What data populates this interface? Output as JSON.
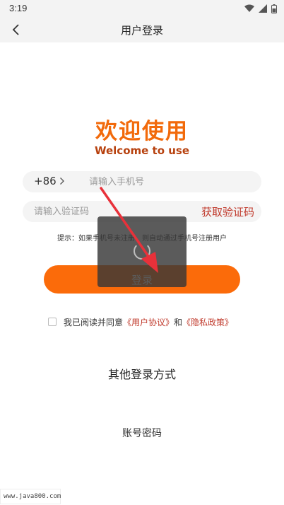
{
  "status_bar": {
    "time": "3:19"
  },
  "header": {
    "title": "用户登录"
  },
  "welcome": {
    "title_cn": "欢迎使用",
    "title_en": "Welcome to use"
  },
  "phone": {
    "country_code": "+86",
    "placeholder": "请输入手机号"
  },
  "code": {
    "placeholder": "请输入验证码",
    "get_code_label": "获取验证码"
  },
  "hint": "提示：如果手机号未注册，则自动通过手机号注册用户",
  "login_button": "登录",
  "agreement": {
    "prefix": "我已阅读并同意",
    "user_agreement": "《用户协议》",
    "and": "和",
    "privacy_policy": "《隐私政策》"
  },
  "other_methods": "其他登录方式",
  "account_login": "账号密码",
  "watermark": "www.java800.com",
  "colors": {
    "accent": "#fb6b0a",
    "link": "#c0392b",
    "annotation": "#e8313a"
  }
}
